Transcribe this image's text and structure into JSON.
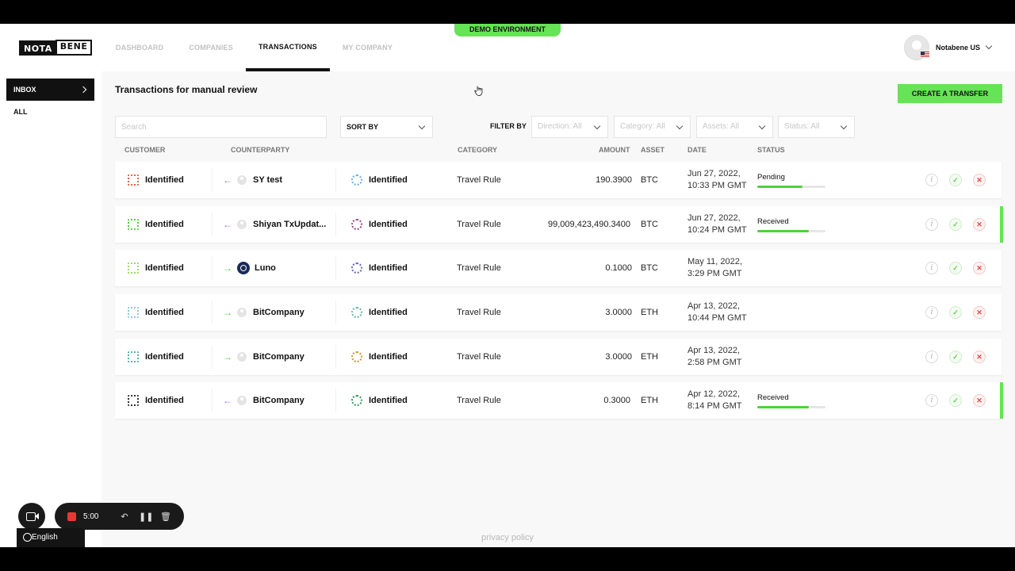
{
  "app": {
    "logo_left": "NOTA",
    "logo_right": "BENE",
    "demo_badge": "DEMO ENVIRONMENT",
    "user_name": "Notabene US"
  },
  "nav": [
    {
      "label": "DASHBOARD"
    },
    {
      "label": "COMPANIES"
    },
    {
      "label": "TRANSACTIONS",
      "active": true
    },
    {
      "label": "MY COMPANY"
    }
  ],
  "sidebar": {
    "inbox_label": "INBOX",
    "all_label": "ALL"
  },
  "main": {
    "title": "Transactions for manual review",
    "create_button": "CREATE A TRANSFER",
    "search_placeholder": "Search",
    "sort_label": "SORT BY",
    "filter_label": "FILTER BY",
    "filters": [
      "Direction: All",
      "Category: All",
      "Assets: All",
      "Status: All"
    ]
  },
  "table": {
    "headers": {
      "customer": "CUSTOMER",
      "counterparty": "COUNTERPARTY",
      "category": "CATEGORY",
      "amount": "AMOUNT",
      "asset": "ASSET",
      "date": "DATE",
      "status": "STATUS"
    },
    "rows": [
      {
        "customer": "Identified",
        "direction": "in",
        "counterparty": "SY test",
        "cp_status": "Identified",
        "category": "Travel Rule",
        "amount": "190.3900",
        "asset": "BTC",
        "date1": "Jun 27, 2022,",
        "date2": "10:33 PM GMT",
        "status": "Pending",
        "progress": 0.66,
        "accent": false,
        "ic1": "#e0624a",
        "ic2": "#6ab0e8"
      },
      {
        "customer": "Identified",
        "direction": "in",
        "counterparty": "Shiyan TxUpdat...",
        "cp_status": "Identified",
        "category": "Travel Rule",
        "amount": "99,009,423,490.3400",
        "asset": "BTC",
        "date1": "Jun 27, 2022,",
        "date2": "10:24 PM GMT",
        "status": "Received",
        "progress": 0.75,
        "accent": true,
        "ic1": "#4fd13c",
        "ic2": "#a04a8a"
      },
      {
        "customer": "Identified",
        "direction": "out",
        "counterparty": "Luno",
        "cp_status": "Identified",
        "category": "Travel Rule",
        "amount": "0.1000",
        "asset": "BTC",
        "date1": "May 11, 2022,",
        "date2": "3:29 PM GMT",
        "status": "",
        "progress": 0,
        "accent": false,
        "ic1": "#9bd86a",
        "ic2": "#6a6ab8"
      },
      {
        "customer": "Identified",
        "direction": "out",
        "counterparty": "BitCompany",
        "cp_status": "Identified",
        "category": "Travel Rule",
        "amount": "3.0000",
        "asset": "ETH",
        "date1": "Apr 13, 2022,",
        "date2": "10:44 PM GMT",
        "status": "",
        "progress": 0,
        "accent": false,
        "ic1": "#8cc8e0",
        "ic2": "#6ab8a8"
      },
      {
        "customer": "Identified",
        "direction": "out",
        "counterparty": "BitCompany",
        "cp_status": "Identified",
        "category": "Travel Rule",
        "amount": "3.0000",
        "asset": "ETH",
        "date1": "Apr 13, 2022,",
        "date2": "2:58 PM GMT",
        "status": "",
        "progress": 0,
        "accent": false,
        "ic1": "#5ab0a8",
        "ic2": "#c89a3a"
      },
      {
        "customer": "Identified",
        "direction": "in",
        "counterparty": "BitCompany",
        "cp_status": "Identified",
        "category": "Travel Rule",
        "amount": "0.3000",
        "asset": "ETH",
        "date1": "Apr 12, 2022,",
        "date2": "8:14 PM GMT",
        "status": "Received",
        "progress": 0.75,
        "accent": true,
        "ic1": "#333333",
        "ic2": "#3a9a5a"
      }
    ]
  },
  "footer": {
    "privacy": "privacy policy",
    "rec_time": "5:00",
    "language": "English"
  }
}
